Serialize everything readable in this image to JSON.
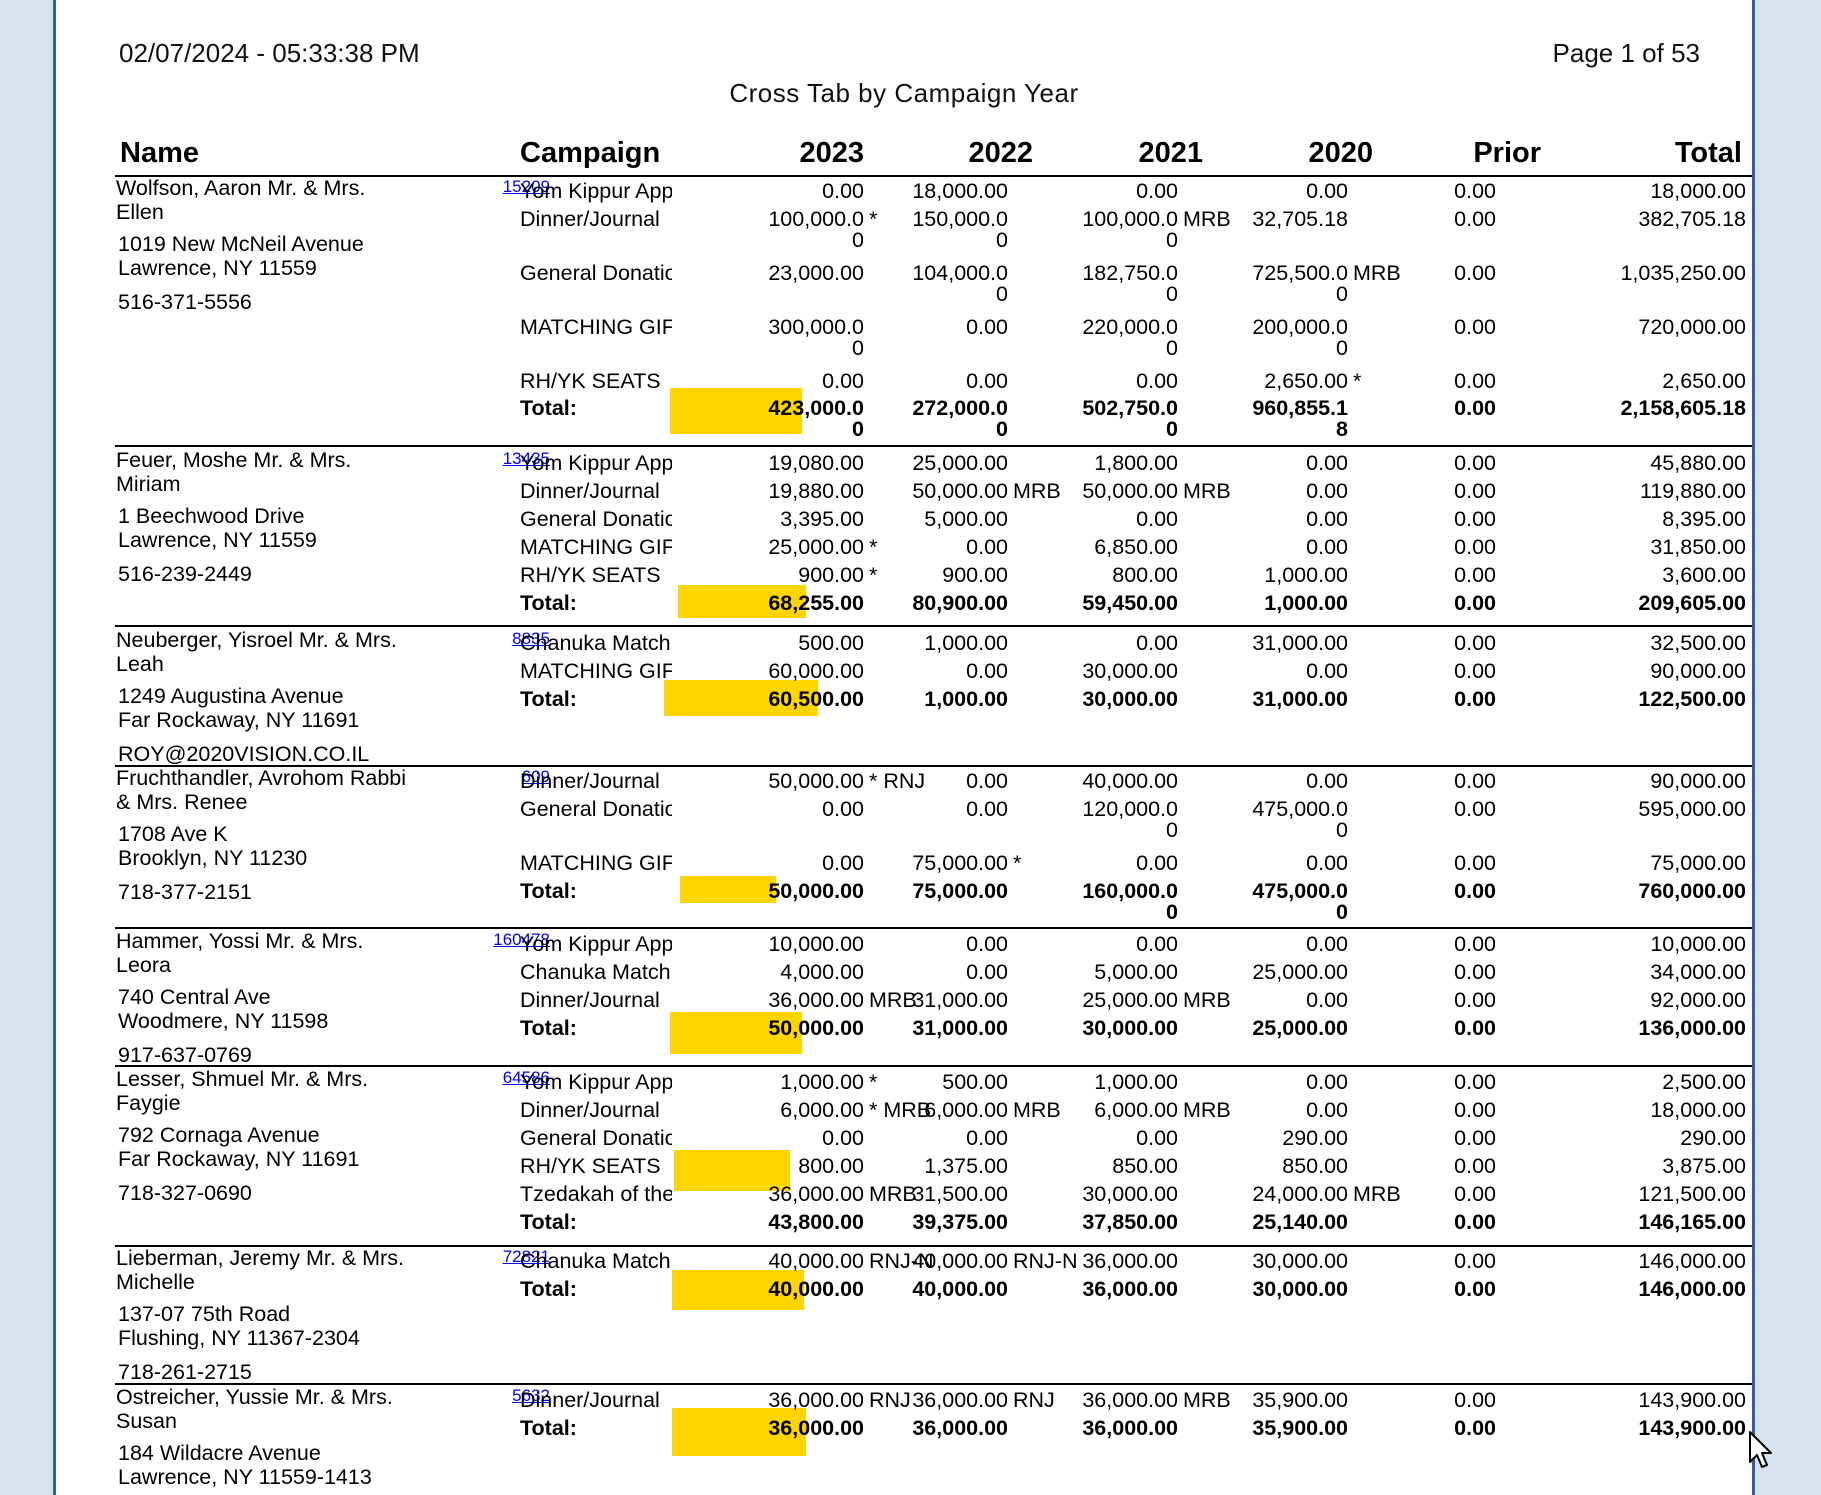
{
  "header": {
    "datetime": "02/07/2024  -  05:33:38 PM",
    "page": "Page 1 of 53",
    "title": "Cross Tab by Campaign Year"
  },
  "columns": [
    "Name",
    "Campaign",
    "2023",
    "2022",
    "2021",
    "2020",
    "Prior",
    "Total"
  ],
  "highlight_color": "#ffd500",
  "link_color": "#0000ee",
  "donors": [
    {
      "name": [
        "Wolfson, Aaron Mr. & Mrs.",
        "Ellen"
      ],
      "address": [
        "1019 New McNeil Avenue",
        "Lawrence, NY 11559"
      ],
      "contact": "516-371-5556",
      "id": "15209",
      "rows": [
        {
          "campaign": "Yom Kippur App",
          "v2023": "0.00",
          "v2022": "18,000.00",
          "v2021": "0.00",
          "v2020": "0.00",
          "prior": "0.00",
          "total": "18,000.00"
        },
        {
          "campaign": "Dinner/Journal",
          "v2023": "100,000.0",
          "v2023_w": "0",
          "m2023": "*",
          "v2022": "150,000.0",
          "v2022_w": "0",
          "v2021": "100,000.0",
          "v2021_w": "0",
          "m2021": "MRB",
          "v2020": "32,705.18",
          "prior": "0.00",
          "total": "382,705.18"
        },
        {
          "campaign": "General Donatioi",
          "v2023": "23,000.00",
          "v2022": "104,000.0",
          "v2022_w": "0",
          "v2021": "182,750.0",
          "v2021_w": "0",
          "v2020": "725,500.0",
          "v2020_w": "0",
          "m2020": "MRB",
          "prior": "0.00",
          "total": "1,035,250.00"
        },
        {
          "campaign": "MATCHING GIFT",
          "v2023": "300,000.0",
          "v2023_w": "0",
          "v2022": "0.00",
          "v2021": "220,000.0",
          "v2021_w": "0",
          "v2020": "200,000.0",
          "v2020_w": "0",
          "prior": "0.00",
          "total": "720,000.00"
        },
        {
          "campaign": "RH/YK SEATS",
          "v2023": "0.00",
          "v2022": "0.00",
          "v2021": "0.00",
          "v2020": "2,650.00",
          "m2020": "*",
          "prior": "0.00",
          "total": "2,650.00"
        },
        {
          "campaign": "Total:",
          "total_row": true,
          "v2023": "423,000.0",
          "v2023_w": "0",
          "v2022": "272,000.0",
          "v2022_w": "0",
          "v2021": "502,750.0",
          "v2021_w": "0",
          "v2020": "960,855.1",
          "v2020_w": "8",
          "prior": "0.00",
          "total": "2,158,605.18"
        }
      ]
    },
    {
      "name": [
        "Feuer, Moshe Mr. & Mrs.",
        "Miriam"
      ],
      "address": [
        "1 Beechwood Drive",
        "Lawrence, NY 11559"
      ],
      "contact": "516-239-2449",
      "id": "13435",
      "rows": [
        {
          "campaign": "Yom Kippur App",
          "v2023": "19,080.00",
          "v2022": "25,000.00",
          "v2021": "1,800.00",
          "v2020": "0.00",
          "prior": "0.00",
          "total": "45,880.00"
        },
        {
          "campaign": "Dinner/Journal",
          "v2023": "19,880.00",
          "v2022": "50,000.00",
          "m2022": "MRB",
          "v2021": "50,000.00",
          "m2021": "MRB",
          "v2020": "0.00",
          "prior": "0.00",
          "total": "119,880.00"
        },
        {
          "campaign": "General Donatioi",
          "v2023": "3,395.00",
          "v2022": "5,000.00",
          "v2021": "0.00",
          "v2020": "0.00",
          "prior": "0.00",
          "total": "8,395.00"
        },
        {
          "campaign": "MATCHING GIFT",
          "v2023": "25,000.00",
          "m2023": "*",
          "v2022": "0.00",
          "v2021": "6,850.00",
          "v2020": "0.00",
          "prior": "0.00",
          "total": "31,850.00"
        },
        {
          "campaign": "RH/YK SEATS",
          "v2023": "900.00",
          "m2023": "*",
          "v2022": "900.00",
          "v2021": "800.00",
          "v2020": "1,000.00",
          "prior": "0.00",
          "total": "3,600.00"
        },
        {
          "campaign": "Total:",
          "total_row": true,
          "v2023": "68,255.00",
          "v2022": "80,900.00",
          "v2021": "59,450.00",
          "v2020": "1,000.00",
          "prior": "0.00",
          "total": "209,605.00"
        }
      ]
    },
    {
      "name": [
        "Neuberger, Yisroel Mr. & Mrs.",
        "Leah"
      ],
      "address": [
        "1249 Augustina Avenue",
        "Far Rockaway, NY 11691"
      ],
      "contact": "ROY@2020VISION.CO.IL",
      "id": "8835",
      "rows": [
        {
          "campaign": "Chanuka Match",
          "v2023": "500.00",
          "v2022": "1,000.00",
          "v2021": "0.00",
          "v2020": "31,000.00",
          "prior": "0.00",
          "total": "32,500.00"
        },
        {
          "campaign": "MATCHING GIFT",
          "v2023": "60,000.00",
          "v2022": "0.00",
          "v2021": "30,000.00",
          "v2020": "0.00",
          "prior": "0.00",
          "total": "90,000.00"
        },
        {
          "campaign": "Total:",
          "total_row": true,
          "v2023": "60,500.00",
          "v2022": "1,000.00",
          "v2021": "30,000.00",
          "v2020": "31,000.00",
          "prior": "0.00",
          "total": "122,500.00"
        }
      ]
    },
    {
      "name": [
        "Fruchthandler, Avrohom Rabbi",
        "& Mrs. Renee"
      ],
      "address": [
        "1708 Ave K",
        "Brooklyn, NY 11230"
      ],
      "contact": "718-377-2151",
      "id": "609",
      "rows": [
        {
          "campaign": "Dinner/Journal",
          "v2023": "50,000.00",
          "m2023": "* RNJ",
          "v2022": "0.00",
          "v2021": "40,000.00",
          "v2020": "0.00",
          "prior": "0.00",
          "total": "90,000.00"
        },
        {
          "campaign": "General Donatioi",
          "v2023": "0.00",
          "v2022": "0.00",
          "v2021": "120,000.0",
          "v2021_w": "0",
          "v2020": "475,000.0",
          "v2020_w": "0",
          "prior": "0.00",
          "total": "595,000.00"
        },
        {
          "campaign": "MATCHING GIFT",
          "v2023": "0.00",
          "v2022": "75,000.00",
          "m2022": "*",
          "v2021": "0.00",
          "v2020": "0.00",
          "prior": "0.00",
          "total": "75,000.00"
        },
        {
          "campaign": "Total:",
          "total_row": true,
          "v2023": "50,000.00",
          "v2022": "75,000.00",
          "v2021": "160,000.0",
          "v2021_w": "0",
          "v2020": "475,000.0",
          "v2020_w": "0",
          "prior": "0.00",
          "total": "760,000.00"
        }
      ]
    },
    {
      "name": [
        "Hammer, Yossi Mr. & Mrs.",
        "Leora"
      ],
      "address": [
        "740 Central Ave",
        "Woodmere, NY 11598"
      ],
      "contact": "917-637-0769",
      "id": "160478",
      "rows": [
        {
          "campaign": "Yom Kippur App",
          "v2023": "10,000.00",
          "v2022": "0.00",
          "v2021": "0.00",
          "v2020": "0.00",
          "prior": "0.00",
          "total": "10,000.00"
        },
        {
          "campaign": "Chanuka Match",
          "v2023": "4,000.00",
          "v2022": "0.00",
          "v2021": "5,000.00",
          "v2020": "25,000.00",
          "prior": "0.00",
          "total": "34,000.00"
        },
        {
          "campaign": "Dinner/Journal",
          "v2023": "36,000.00",
          "m2023": "MRB",
          "v2022": "31,000.00",
          "v2021": "25,000.00",
          "m2021": "MRB",
          "v2020": "0.00",
          "prior": "0.00",
          "total": "92,000.00"
        },
        {
          "campaign": "Total:",
          "total_row": true,
          "v2023": "50,000.00",
          "v2022": "31,000.00",
          "v2021": "30,000.00",
          "v2020": "25,000.00",
          "prior": "0.00",
          "total": "136,000.00"
        }
      ]
    },
    {
      "name": [
        "Lesser, Shmuel Mr. & Mrs.",
        "Faygie"
      ],
      "address": [
        "792 Cornaga Avenue",
        "Far Rockaway, NY 11691"
      ],
      "contact": "718-327-0690",
      "id": "64586",
      "rows": [
        {
          "campaign": "Yom Kippur App",
          "v2023": "1,000.00",
          "m2023": "*",
          "v2022": "500.00",
          "v2021": "1,000.00",
          "v2020": "0.00",
          "prior": "0.00",
          "total": "2,500.00"
        },
        {
          "campaign": "Dinner/Journal",
          "v2023": "6,000.00",
          "m2023": "* MRB",
          "v2022": "6,000.00",
          "m2022": "MRB",
          "v2021": "6,000.00",
          "m2021": "MRB",
          "v2020": "0.00",
          "prior": "0.00",
          "total": "18,000.00"
        },
        {
          "campaign": "General Donatioi",
          "v2023": "0.00",
          "v2022": "0.00",
          "v2021": "0.00",
          "v2020": "290.00",
          "prior": "0.00",
          "total": "290.00"
        },
        {
          "campaign": "RH/YK SEATS",
          "v2023": "800.00",
          "v2022": "1,375.00",
          "v2021": "850.00",
          "v2020": "850.00",
          "prior": "0.00",
          "total": "3,875.00"
        },
        {
          "campaign": "Tzedakah of the",
          "v2023": "36,000.00",
          "m2023": "MRB",
          "v2022": "31,500.00",
          "v2021": "30,000.00",
          "v2020": "24,000.00",
          "m2020": "MRB",
          "prior": "0.00",
          "total": "121,500.00"
        },
        {
          "campaign": "Total:",
          "total_row": true,
          "v2023": "43,800.00",
          "v2022": "39,375.00",
          "v2021": "37,850.00",
          "v2020": "25,140.00",
          "prior": "0.00",
          "total": "146,165.00"
        }
      ]
    },
    {
      "name": [
        "Lieberman, Jeremy Mr. & Mrs.",
        "Michelle"
      ],
      "address": [
        "137-07 75th Road",
        "Flushing, NY 11367-2304"
      ],
      "contact": "718-261-2715",
      "id": "72821",
      "rows": [
        {
          "campaign": "Chanuka Match",
          "v2023": "40,000.00",
          "m2023": "RNJ-N",
          "v2022": "40,000.00",
          "m2022": "RNJ-N",
          "v2021": "36,000.00",
          "v2020": "30,000.00",
          "prior": "0.00",
          "total": "146,000.00"
        },
        {
          "campaign": "Total:",
          "total_row": true,
          "v2023": "40,000.00",
          "v2022": "40,000.00",
          "v2021": "36,000.00",
          "v2020": "30,000.00",
          "prior": "0.00",
          "total": "146,000.00"
        }
      ]
    },
    {
      "name": [
        "Ostreicher, Yussie Mr. & Mrs.",
        "Susan"
      ],
      "address": [
        "184 Wildacre Avenue",
        "Lawrence, NY 11559-1413"
      ],
      "contact": "",
      "id": "5632",
      "rows": [
        {
          "campaign": "Dinner/Journal",
          "v2023": "36,000.00",
          "m2023": "RNJ",
          "v2022": "36,000.00",
          "m2022": "RNJ",
          "v2021": "36,000.00",
          "m2021": "MRB",
          "v2020": "35,900.00",
          "prior": "0.00",
          "total": "143,900.00"
        },
        {
          "campaign": "Total:",
          "total_row": true,
          "v2023": "36,000.00",
          "v2022": "36,000.00",
          "v2021": "36,000.00",
          "v2020": "35,900.00",
          "prior": "0.00",
          "total": "143,900.00"
        }
      ]
    }
  ]
}
